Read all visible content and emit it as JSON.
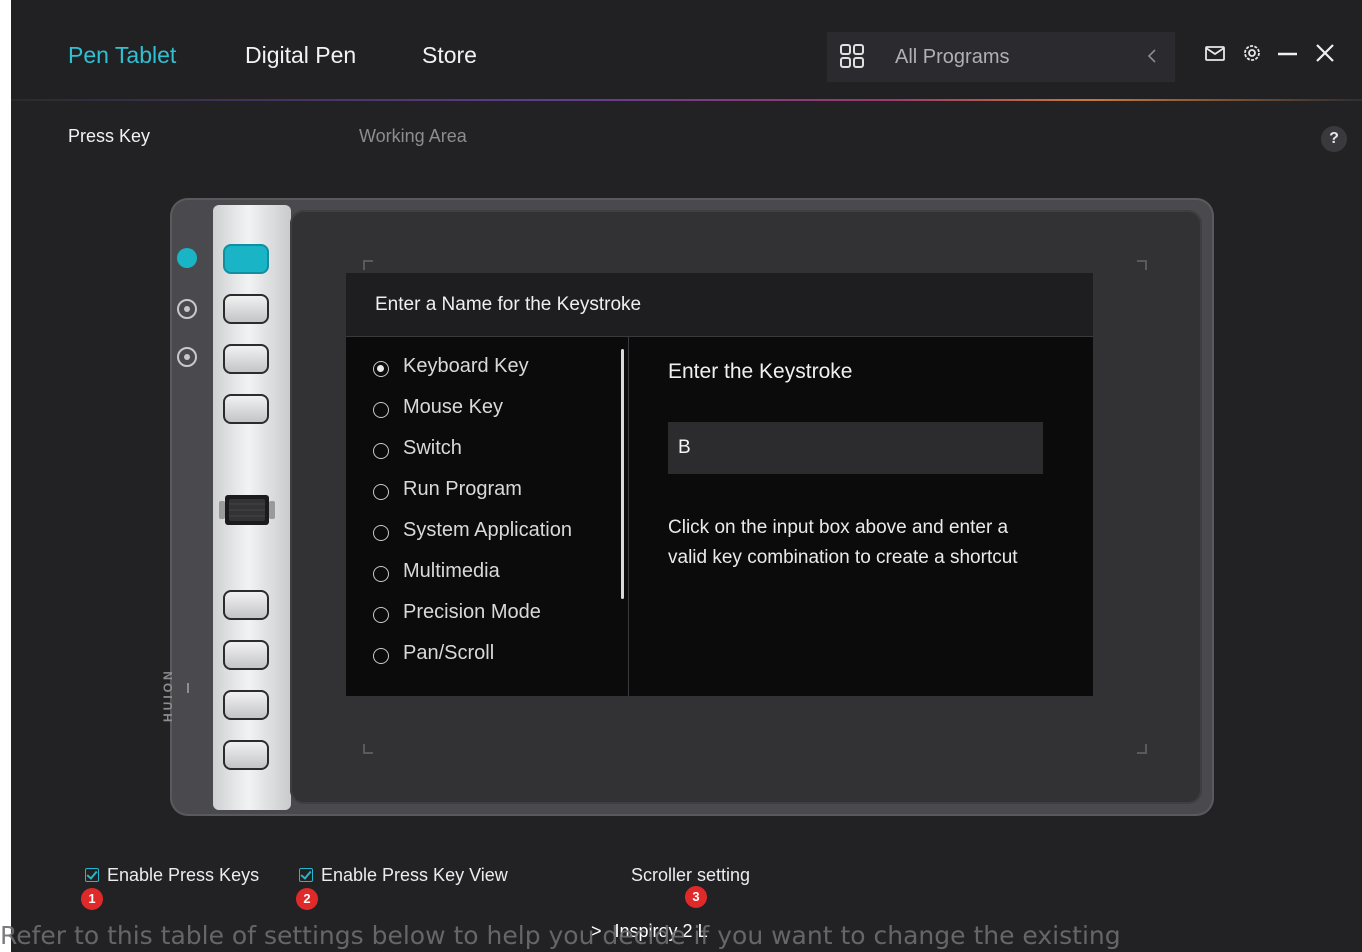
{
  "nav": {
    "tabs": [
      {
        "label": "Pen Tablet",
        "active": true
      },
      {
        "label": "Digital Pen",
        "active": false
      },
      {
        "label": "Store",
        "active": false
      }
    ],
    "program_selector": {
      "label": "All Programs",
      "icon": "grid-icon"
    },
    "window_icons": [
      "mail-icon",
      "gear-icon",
      "minimize-icon",
      "close-icon"
    ]
  },
  "subtabs": {
    "press_key": "Press Key",
    "working_area": "Working Area",
    "help": "?"
  },
  "dialog": {
    "title": "Enter a Name for the Keystroke",
    "types": [
      {
        "label": "Keyboard Key",
        "selected": true
      },
      {
        "label": "Mouse Key",
        "selected": false
      },
      {
        "label": "Switch",
        "selected": false
      },
      {
        "label": "Run Program",
        "selected": false
      },
      {
        "label": "System Application",
        "selected": false
      },
      {
        "label": "Multimedia",
        "selected": false
      },
      {
        "label": "Precision Mode",
        "selected": false
      },
      {
        "label": "Pan/Scroll",
        "selected": false
      }
    ],
    "keystroke_title": "Enter the Keystroke",
    "keystroke_value": "B",
    "keystroke_help": "Click on the input box above and enter a valid key combination to create a shortcut"
  },
  "tablet": {
    "logo": "HUION"
  },
  "bottom": {
    "enable_press_keys": {
      "label": "Enable Press Keys",
      "checked": true,
      "badge": "1"
    },
    "enable_press_key_view": {
      "label": "Enable Press Key View",
      "checked": true,
      "badge": "2"
    },
    "scroller_setting": {
      "label": "Scroller setting",
      "badge": "3"
    },
    "device_name": "Inspiroy 2 L",
    "device_chevron": ">"
  },
  "overlay_text": "Refer to this table of settings below to help you decide if you want to change the existing",
  "colors": {
    "accent": "#2fc1d3",
    "selected_key": "#19b4c6",
    "badge": "#e02a2a",
    "background": "#222225"
  }
}
